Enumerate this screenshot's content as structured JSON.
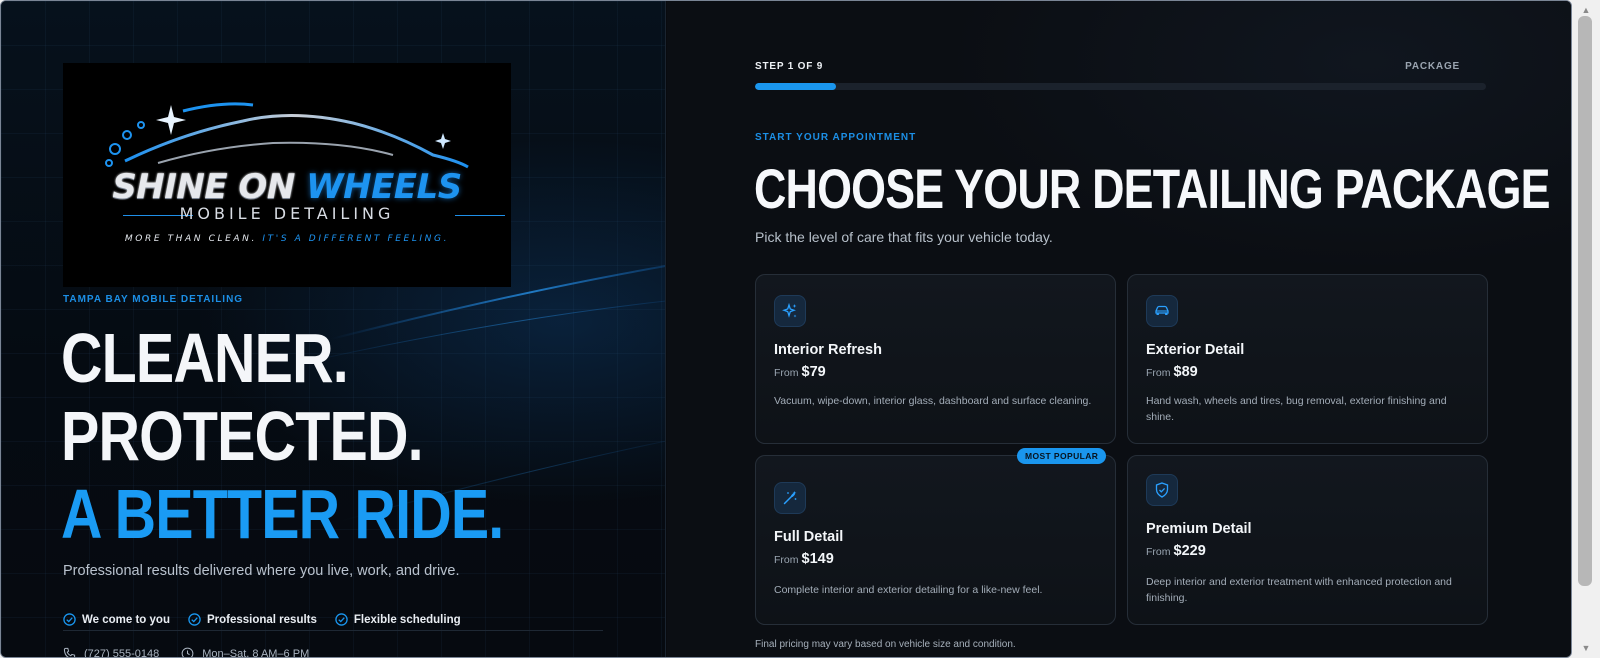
{
  "hero": {
    "logo": {
      "brand_part1": "SHINE ON",
      "brand_part2": "WHEELS",
      "subtitle": "MOBILE DETAILING",
      "tagline_part1": "MORE THAN CLEAN.",
      "tagline_part2": "IT'S A DIFFERENT FEELING."
    },
    "eyebrow": "TAMPA BAY MOBILE DETAILING",
    "headline": [
      "CLEANER.",
      "PROTECTED.",
      "A BETTER RIDE."
    ],
    "subheadline": "Professional results delivered where you live, work, and drive.",
    "features": [
      "We come to you",
      "Professional results",
      "Flexible scheduling"
    ],
    "phone": "(727) 555-0148",
    "hours": "Mon–Sat, 8 AM–6 PM"
  },
  "wizard": {
    "step_label": "STEP 1 OF 9",
    "section_label": "PACKAGE",
    "progress_fraction": 0.111,
    "eyebrow": "START YOUR APPOINTMENT",
    "title": "CHOOSE YOUR DETAILING PACKAGE",
    "subtitle": "Pick the level of care that fits your vehicle today.",
    "from_label": "From",
    "packages": [
      {
        "name": "Interior Refresh",
        "price": "$79",
        "description": "Vacuum, wipe-down, interior glass, dashboard and surface cleaning.",
        "icon": "sparkles-icon"
      },
      {
        "name": "Exterior Detail",
        "price": "$89",
        "description": "Hand wash, wheels and tires, bug removal, exterior finishing and shine.",
        "icon": "car-icon"
      },
      {
        "name": "Full Detail",
        "price": "$149",
        "description": "Complete interior and exterior detailing for a like-new feel.",
        "icon": "magic-wand-icon",
        "badge": "MOST POPULAR"
      },
      {
        "name": "Premium Detail",
        "price": "$229",
        "description": "Deep interior and exterior treatment with enhanced protection and finishing.",
        "icon": "shield-check-icon"
      }
    ],
    "footnote": "Final pricing may vary based on vehicle size and condition."
  },
  "colors": {
    "accent": "#1a96ee",
    "background": "#0b0e13",
    "card_border": "#262e38"
  }
}
